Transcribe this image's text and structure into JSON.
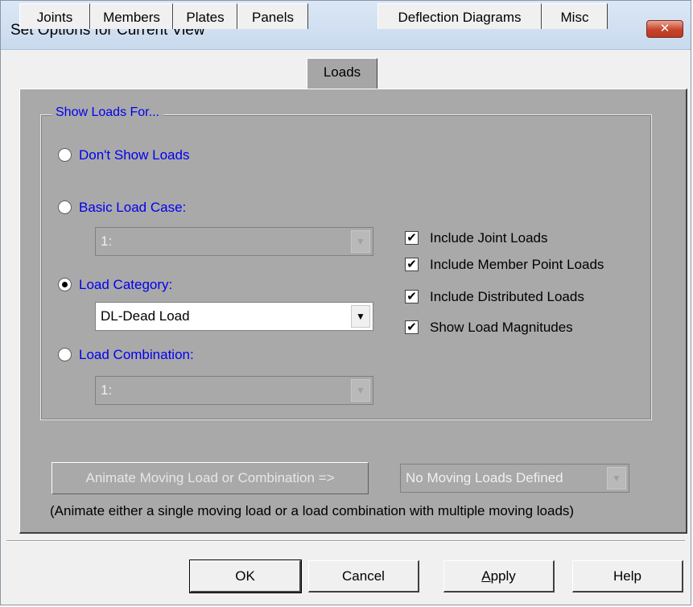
{
  "window": {
    "title": "Set Options for Current View",
    "close_label": "✕"
  },
  "tabs": [
    {
      "label": "Joints"
    },
    {
      "label": "Members"
    },
    {
      "label": "Plates"
    },
    {
      "label": "Panels"
    },
    {
      "label": "Loads",
      "active": true
    },
    {
      "label": "Deflection Diagrams"
    },
    {
      "label": "Misc"
    }
  ],
  "group": {
    "title": "Show Loads For...",
    "options": {
      "dont_show": "Don't Show Loads",
      "basic_case": "Basic Load Case:",
      "load_category": "Load Category:",
      "load_combination": "Load Combination:"
    },
    "selected_option": "load_category",
    "basic_case_select": {
      "value": "1:",
      "enabled": false
    },
    "category_select": {
      "value": "DL-Dead Load",
      "enabled": true
    },
    "combination_select": {
      "value": "1:",
      "enabled": false
    }
  },
  "checkboxes": [
    {
      "label": "Include Joint Loads",
      "checked": true
    },
    {
      "label": "Include Member Point Loads",
      "checked": true
    },
    {
      "label": "Include Distributed Loads",
      "checked": true
    },
    {
      "label": "Show Load Magnitudes",
      "checked": true
    }
  ],
  "animate": {
    "button_label": "Animate Moving Load or Combination =>",
    "select_value": "No Moving Loads Defined",
    "note": "(Animate either a single moving load or a load combination with multiple moving loads)"
  },
  "buttons": {
    "ok": "OK",
    "cancel": "Cancel",
    "apply_first": "A",
    "apply_rest": "pply",
    "help": "Help"
  },
  "icons": {
    "dropdown_arrow": "▼",
    "check_mark": "✔"
  }
}
